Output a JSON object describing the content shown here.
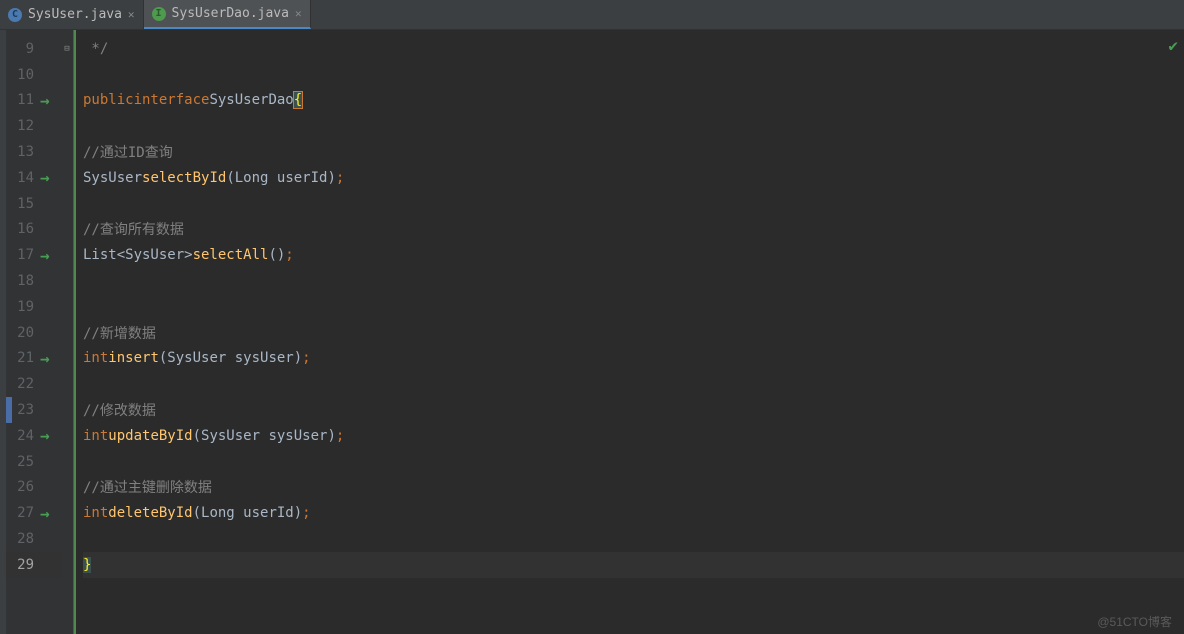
{
  "tabs": [
    {
      "label": "SysUser.java",
      "icon": "C"
    },
    {
      "label": "SysUserDao.java",
      "icon": "I"
    }
  ],
  "lines": {
    "start": 9,
    "end": 29,
    "arrows": [
      11,
      14,
      17,
      21,
      24,
      27
    ],
    "currentLine": 29,
    "breakpointLine": 23
  },
  "code": {
    "l9": {
      "comment": " */"
    },
    "l11": {
      "kw1": "public",
      "kw2": "interface",
      "type": "SysUserDao",
      "brace": "{"
    },
    "l13": {
      "comment": "//通过ID查询"
    },
    "l14": {
      "type": "SysUser",
      "method": "selectById",
      "params": "(Long userId)"
    },
    "l16": {
      "comment": "//查询所有数据"
    },
    "l17": {
      "type": "List<SysUser>",
      "method": "selectAll",
      "params": "()"
    },
    "l20": {
      "comment": "//新增数据"
    },
    "l21": {
      "kw": "int",
      "method": "insert",
      "params": "(SysUser sysUser)"
    },
    "l23": {
      "comment": "//修改数据"
    },
    "l24": {
      "kw": "int",
      "method": "updateById",
      "params": "(SysUser sysUser)"
    },
    "l26": {
      "comment": "//通过主键删除数据"
    },
    "l27": {
      "kw": "int",
      "method": "deleteById",
      "params": "(Long userId)"
    },
    "l29": {
      "brace": "}"
    }
  },
  "watermark": "@51CTO博客",
  "semi": ";"
}
